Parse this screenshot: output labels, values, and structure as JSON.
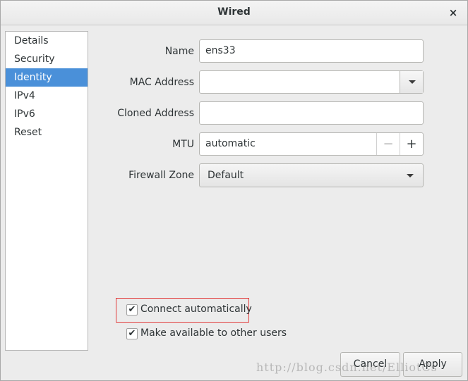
{
  "window": {
    "title": "Wired",
    "close_icon": "×"
  },
  "sidebar": {
    "items": [
      {
        "label": "Details",
        "active": false
      },
      {
        "label": "Security",
        "active": false
      },
      {
        "label": "Identity",
        "active": true
      },
      {
        "label": "IPv4",
        "active": false
      },
      {
        "label": "IPv6",
        "active": false
      },
      {
        "label": "Reset",
        "active": false
      }
    ]
  },
  "form": {
    "name_label": "Name",
    "name_value": "ens33",
    "mac_label": "MAC Address",
    "mac_value": "",
    "cloned_label": "Cloned Address",
    "cloned_value": "",
    "mtu_label": "MTU",
    "mtu_value": "automatic",
    "mtu_minus": "−",
    "mtu_plus": "+",
    "firewall_label": "Firewall Zone",
    "firewall_value": "Default"
  },
  "options": {
    "connect_auto_label": "Connect automatically",
    "connect_auto_checked": true,
    "available_users_label": "Make available to other users",
    "available_users_checked": true,
    "check_glyph": "✔"
  },
  "buttons": {
    "cancel": "Cancel",
    "apply": "Apply"
  },
  "watermark": "http://blog.csdn.net/ElliotCs",
  "colors": {
    "accent": "#4a90d9",
    "highlight": "#e23d3d"
  }
}
